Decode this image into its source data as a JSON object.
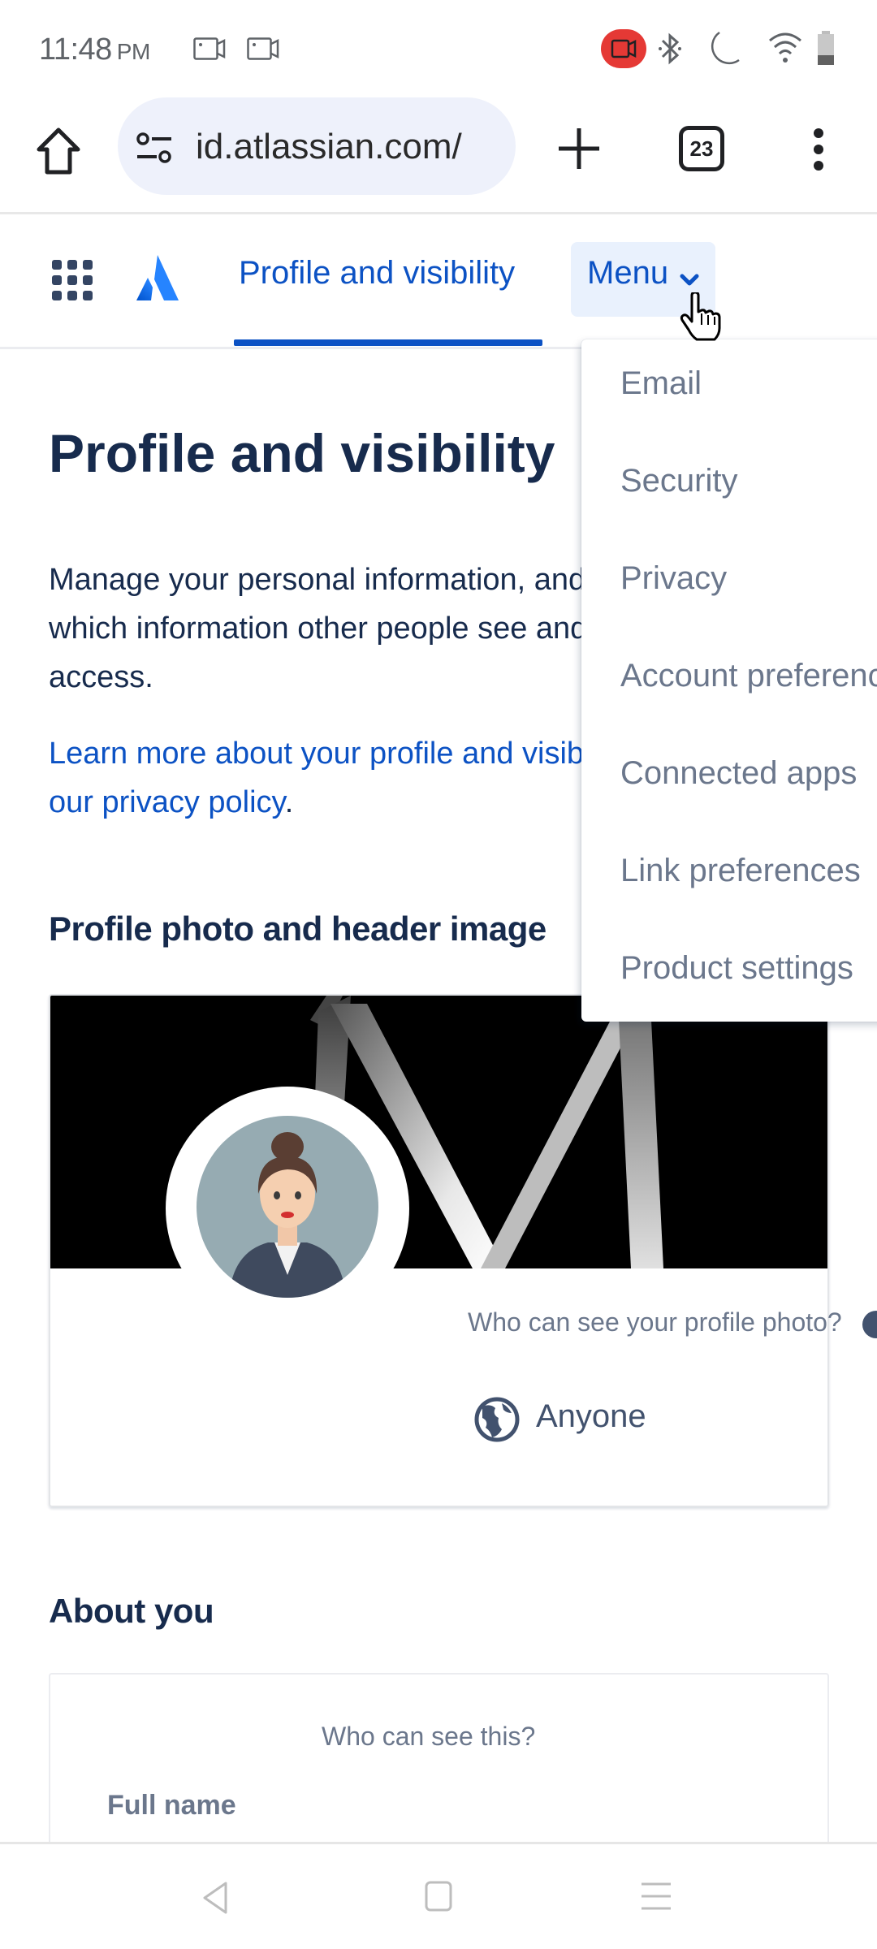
{
  "status_bar": {
    "time": "11:48",
    "ampm": "PM",
    "icons": [
      "screen-record-icon",
      "screen-record-icon",
      "recording-active-icon",
      "bluetooth-icon",
      "do-not-disturb-moon-icon",
      "wifi-icon",
      "battery-icon"
    ],
    "record_badge_color": "#e53935"
  },
  "browser": {
    "url": "id.atlassian.com/",
    "tab_count": "23"
  },
  "site_nav": {
    "active_tab": "Profile and visibility",
    "menu_label": "Menu",
    "accent_color": "#0c52c4"
  },
  "dropdown": {
    "items": [
      {
        "label": "Email"
      },
      {
        "label": "Security"
      },
      {
        "label": "Privacy"
      },
      {
        "label": "Account preferences"
      },
      {
        "label": "Connected apps"
      },
      {
        "label": "Link preferences"
      },
      {
        "label": "Product settings"
      }
    ]
  },
  "main": {
    "title": "Profile and visibility",
    "description_lines": [
      "Manage your personal information, and control",
      "which information other people see and apps can",
      "access."
    ],
    "learn_more_line1": "Learn more about your profile and visibility or view",
    "learn_more_line2": "our privacy policy",
    "learn_more_period": ".",
    "photo_section": {
      "title": "Profile photo and header image",
      "who_can_see": "Who can see your profile photo?",
      "visibility": "Anyone"
    },
    "about_section": {
      "title": "About you",
      "who_can_see": "Who can see this?",
      "field_label": "Full name"
    }
  }
}
